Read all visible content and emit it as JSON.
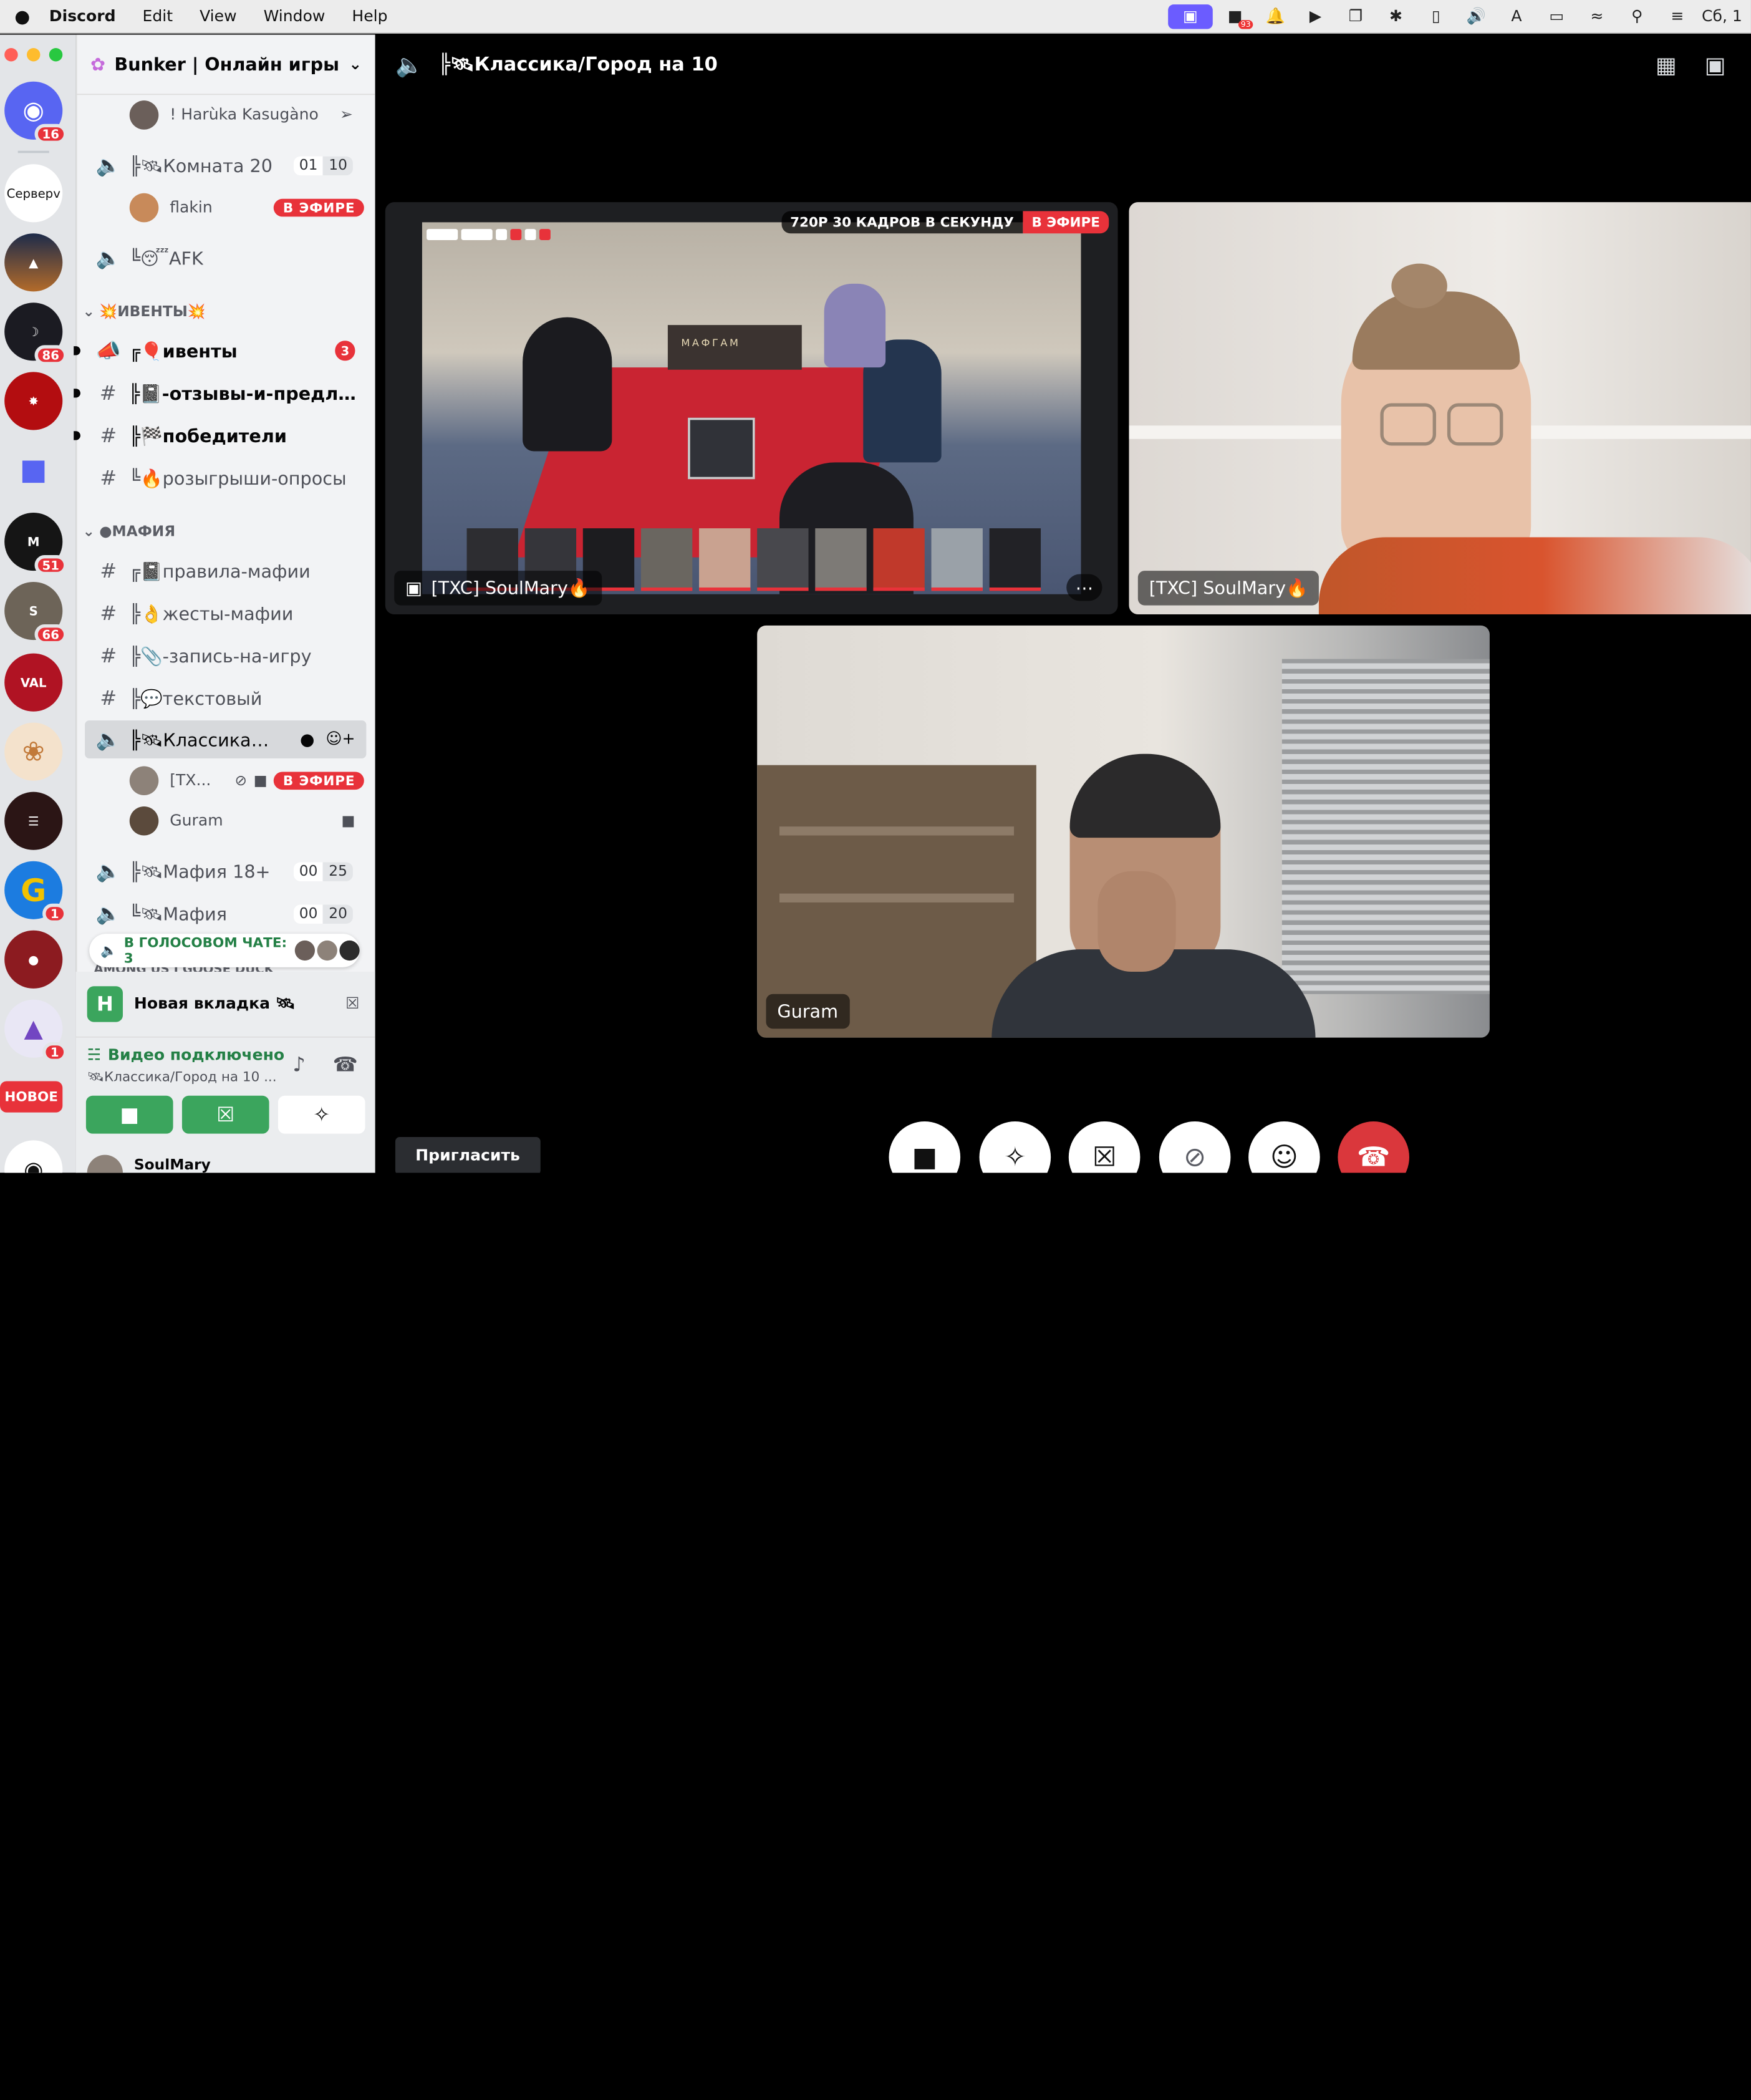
{
  "menubar": {
    "apple": "",
    "app": "Discord",
    "items": [
      "Edit",
      "View",
      "Window",
      "Help"
    ],
    "tray_badge": "93",
    "clock": "Сб, 1"
  },
  "rail": {
    "servers_label": "Серверv",
    "new_label": "НОВОЕ",
    "badges": {
      "home": "16",
      "s3": "86",
      "s6": "51",
      "s7": "66",
      "s11": "1",
      "s13": "1"
    }
  },
  "server": {
    "name": "Bunker | Онлайн игры"
  },
  "channels": {
    "top_user": "! Harùka Kasugàno",
    "room20": {
      "name": "╠🛰Комната 20",
      "count": "01",
      "limit": "10",
      "user": "flakin"
    },
    "afk": "╚😴AFK",
    "events_cat": "💥ИВЕНТЫ💥",
    "events": [
      {
        "name": "╔🎈ивенты",
        "badge": "3"
      },
      {
        "name": "╠📓-отзывы-и-предло..."
      },
      {
        "name": "╠🏁победители"
      },
      {
        "name": "╚🔥розыгрыши-опросы"
      }
    ],
    "mafia_cat": "●МАФИЯ",
    "mafia": [
      {
        "name": "╔📓правила-мафии"
      },
      {
        "name": "╠👌жесты-мафии"
      },
      {
        "name": "╠📎-запись-на-игру"
      },
      {
        "name": "╠💬текстовый"
      }
    ],
    "classic": {
      "name": "╠🛰Классика/Гор...",
      "user1": "[TX...",
      "user2": "Guram"
    },
    "mafia18": {
      "name": "╠🛰Мафия 18+",
      "count": "00",
      "limit": "25"
    },
    "mafia_vc": {
      "name": "╚🛰Мафия",
      "count": "00",
      "limit": "20"
    },
    "live_label": "В ЭФИРЕ",
    "among_cat": "AMONG US I GOOSE DUCK"
  },
  "voice_pill": "В ГОЛОСОВОМ ЧАТЕ: 3",
  "newtab": {
    "icon_letter": "H",
    "label": "Новая вкладка 🛰"
  },
  "connection": {
    "status": "Видео подключено",
    "channel": "🛰Классика/Город на 10 ..."
  },
  "userbar": {
    "name": "SoulMary"
  },
  "call": {
    "title": "╠🛰Классика/Город на 10",
    "stream_quality": "720P 30 КАДРОВ В СЕКУНДУ",
    "stream_live": "В ЭФИРЕ",
    "stream_name": "[TXC] SoulMary🔥",
    "cam_name": "[TXC] SoulMary🔥",
    "guram_name": "Guram",
    "invite": "Пригласить",
    "brand_text": "МАФГАМ"
  },
  "colors": {
    "live_red": "#e8323a",
    "green": "#248046",
    "blurple": "#5865f2",
    "sidebar_bg": "#f2f3f5"
  }
}
